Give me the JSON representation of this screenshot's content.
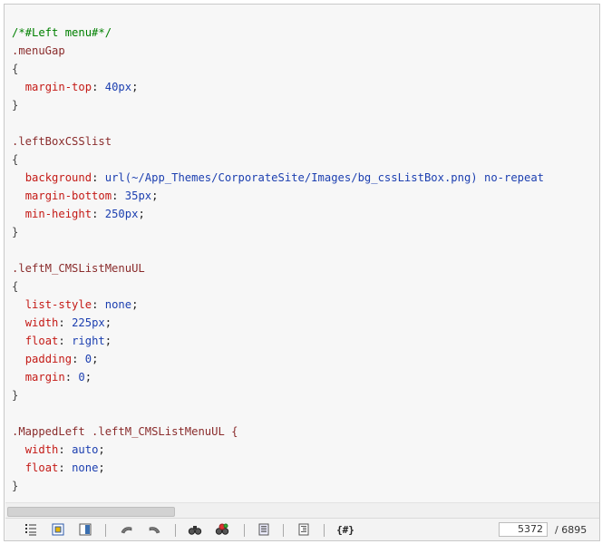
{
  "code_lines": [
    [
      {
        "t": "/*#Left menu#*/",
        "c": "comment"
      }
    ],
    [
      {
        "t": ".menuGap",
        "c": "sel"
      }
    ],
    [
      {
        "t": "{",
        "c": "brace"
      }
    ],
    [
      {
        "t": "  ",
        "c": "punct"
      },
      {
        "t": "margin-top",
        "c": "prop"
      },
      {
        "t": ": ",
        "c": "punct"
      },
      {
        "t": "40px",
        "c": "val"
      },
      {
        "t": ";",
        "c": "punct"
      }
    ],
    [
      {
        "t": "}",
        "c": "brace"
      }
    ],
    [],
    [
      {
        "t": ".leftBoxCSSlist",
        "c": "sel"
      }
    ],
    [
      {
        "t": "{",
        "c": "brace"
      }
    ],
    [
      {
        "t": "  ",
        "c": "punct"
      },
      {
        "t": "background",
        "c": "prop"
      },
      {
        "t": ": ",
        "c": "punct"
      },
      {
        "t": "url(~/App_Themes/CorporateSite/Images/bg_cssListBox.png) no-repeat",
        "c": "val"
      }
    ],
    [
      {
        "t": "  ",
        "c": "punct"
      },
      {
        "t": "margin-bottom",
        "c": "prop"
      },
      {
        "t": ": ",
        "c": "punct"
      },
      {
        "t": "35px",
        "c": "val"
      },
      {
        "t": ";",
        "c": "punct"
      }
    ],
    [
      {
        "t": "  ",
        "c": "punct"
      },
      {
        "t": "min-height",
        "c": "prop"
      },
      {
        "t": ": ",
        "c": "punct"
      },
      {
        "t": "250px",
        "c": "val"
      },
      {
        "t": ";",
        "c": "punct"
      }
    ],
    [
      {
        "t": "}",
        "c": "brace"
      }
    ],
    [],
    [
      {
        "t": ".leftM_CMSListMenuUL",
        "c": "sel"
      }
    ],
    [
      {
        "t": "{",
        "c": "brace"
      }
    ],
    [
      {
        "t": "  ",
        "c": "punct"
      },
      {
        "t": "list-style",
        "c": "prop"
      },
      {
        "t": ": ",
        "c": "punct"
      },
      {
        "t": "none",
        "c": "val"
      },
      {
        "t": ";",
        "c": "punct"
      }
    ],
    [
      {
        "t": "  ",
        "c": "punct"
      },
      {
        "t": "width",
        "c": "prop"
      },
      {
        "t": ": ",
        "c": "punct"
      },
      {
        "t": "225px",
        "c": "val"
      },
      {
        "t": ";",
        "c": "punct"
      }
    ],
    [
      {
        "t": "  ",
        "c": "punct"
      },
      {
        "t": "float",
        "c": "prop"
      },
      {
        "t": ": ",
        "c": "punct"
      },
      {
        "t": "right",
        "c": "val"
      },
      {
        "t": ";",
        "c": "punct"
      }
    ],
    [
      {
        "t": "  ",
        "c": "punct"
      },
      {
        "t": "padding",
        "c": "prop"
      },
      {
        "t": ": ",
        "c": "punct"
      },
      {
        "t": "0",
        "c": "val"
      },
      {
        "t": ";",
        "c": "punct"
      }
    ],
    [
      {
        "t": "  ",
        "c": "punct"
      },
      {
        "t": "margin",
        "c": "prop"
      },
      {
        "t": ": ",
        "c": "punct"
      },
      {
        "t": "0",
        "c": "val"
      },
      {
        "t": ";",
        "c": "punct"
      }
    ],
    [
      {
        "t": "}",
        "c": "brace"
      }
    ],
    [],
    [
      {
        "t": ".MappedLeft .leftM_CMSListMenuUL {",
        "c": "sel"
      }
    ],
    [
      {
        "t": "  ",
        "c": "punct"
      },
      {
        "t": "width",
        "c": "prop"
      },
      {
        "t": ": ",
        "c": "punct"
      },
      {
        "t": "auto",
        "c": "val"
      },
      {
        "t": ";",
        "c": "punct"
      }
    ],
    [
      {
        "t": "  ",
        "c": "punct"
      },
      {
        "t": "float",
        "c": "prop"
      },
      {
        "t": ": ",
        "c": "punct"
      },
      {
        "t": "none",
        "c": "val"
      },
      {
        "t": ";",
        "c": "punct"
      }
    ],
    [
      {
        "t": "}",
        "c": "brace"
      }
    ]
  ],
  "toolbar": {
    "buttons": [
      {
        "name": "line-numbers-icon"
      },
      {
        "name": "highlight-icon"
      },
      {
        "name": "fullscreen-icon"
      },
      {
        "name": "undo-icon"
      },
      {
        "name": "redo-icon"
      },
      {
        "name": "find-icon"
      },
      {
        "name": "replace-icon"
      },
      {
        "name": "select-all-icon"
      },
      {
        "name": "indent-icon"
      },
      {
        "name": "hash-icon",
        "label": "{#}"
      }
    ],
    "position_value": "5372",
    "position_total": "/ 6895"
  },
  "colors": {
    "comment": "#008000",
    "selector": "#8a2c2c",
    "property": "#c41a16",
    "value": "#1c3fb0",
    "editor_bg": "#f7f7f7"
  }
}
